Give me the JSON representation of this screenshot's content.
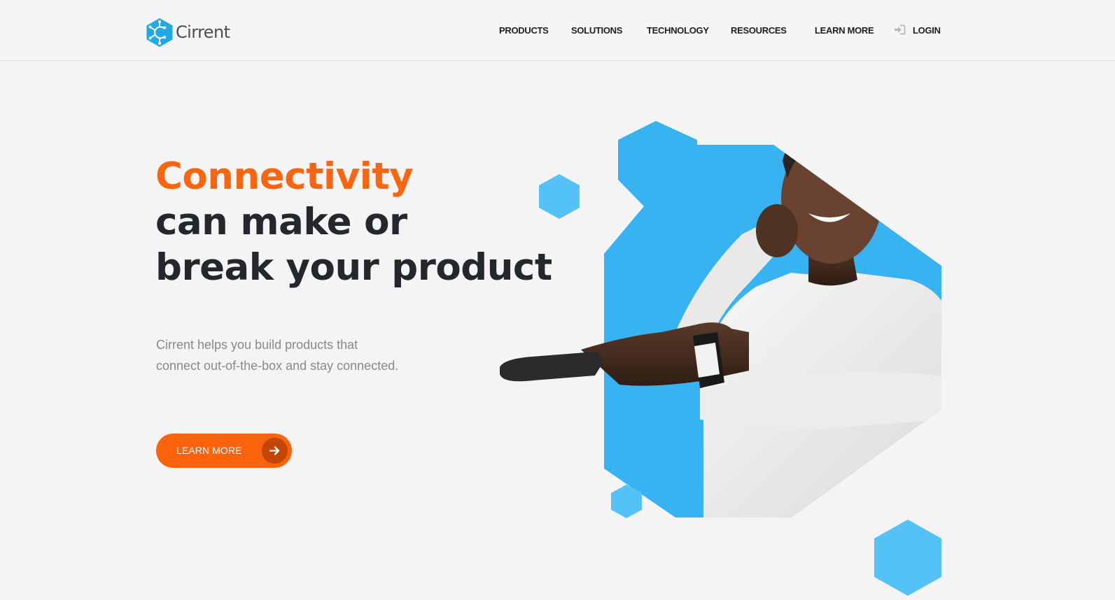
{
  "brand": {
    "name": "Cirrent",
    "logo_color": "#1fa7e6"
  },
  "nav": {
    "items": [
      {
        "label": "PRODUCTS"
      },
      {
        "label": "SOLUTIONS"
      },
      {
        "label": "TECHNOLOGY"
      },
      {
        "label": "RESOURCES"
      },
      {
        "label": "LEARN MORE"
      }
    ],
    "login_label": "LOGIN",
    "login_icon": "sign-in-icon"
  },
  "hero": {
    "headline_accent": "Connectivity",
    "headline_line2": "can make or",
    "headline_line3": "break your product",
    "subtext_line1": "Cirrent helps you build products that",
    "subtext_line2": "connect out-of-the-box and stay connected.",
    "cta_label": "LEARN MORE",
    "cta_icon": "arrow-right-icon",
    "image": "person-holding-remote-photo"
  },
  "colors": {
    "accent": "#fa6510",
    "headline": "#24282c",
    "brand_blue": "#3bb8f5",
    "hex_light_blue": "#55c2f7"
  }
}
